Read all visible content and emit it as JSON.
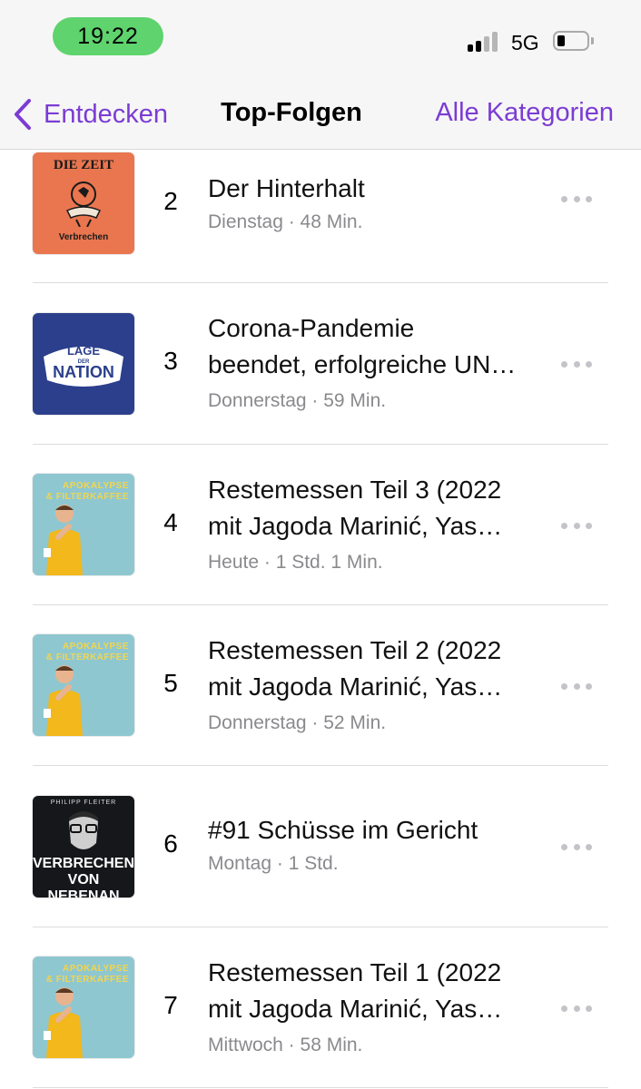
{
  "status_bar": {
    "time": "19:22",
    "network": "5G"
  },
  "nav": {
    "back_label": "Entdecken",
    "title": "Top-Folgen",
    "right_label": "Alle Kategorien"
  },
  "accent_color": "#7b3cd4",
  "episodes": [
    {
      "rank": "2",
      "title_lines": [
        "Der Hinterhalt"
      ],
      "meta": "Dienstag · 48 Min.",
      "artwork": {
        "kind": "zeit",
        "brand": "DIE ZEIT",
        "subtitle": "Verbrechen"
      }
    },
    {
      "rank": "3",
      "title_lines": [
        "Corona-Pandemie",
        "beendet, erfolgreiche UN…"
      ],
      "meta": "Donnerstag · 59 Min.",
      "artwork": {
        "kind": "lage",
        "word1": "LAGE",
        "word2": "DER",
        "word3": "NATION"
      }
    },
    {
      "rank": "4",
      "title_lines": [
        "Restemessen Teil 3 (2022",
        "mit Jagoda Marinić, Yas…"
      ],
      "meta": "Heute · 1 Std. 1 Min.",
      "artwork": {
        "kind": "apokalypse",
        "line1": "APOKALYPSE",
        "line2": "& FILTERKAFFEE"
      }
    },
    {
      "rank": "5",
      "title_lines": [
        "Restemessen Teil 2 (2022",
        "mit Jagoda Marinić, Yas…"
      ],
      "meta": "Donnerstag · 52 Min.",
      "artwork": {
        "kind": "apokalypse",
        "line1": "APOKALYPSE",
        "line2": "& FILTERKAFFEE"
      }
    },
    {
      "rank": "6",
      "title_lines": [
        "#91 Schüsse im Gericht"
      ],
      "meta": "Montag · 1 Std.",
      "artwork": {
        "kind": "verbrechen",
        "top": "PHILIPP FLEITER",
        "line1": "VERBRECHEN",
        "line2": "VON NEBENAN"
      }
    },
    {
      "rank": "7",
      "title_lines": [
        "Restemessen Teil 1 (2022",
        "mit Jagoda Marinić, Yas…"
      ],
      "meta": "Mittwoch · 58 Min.",
      "artwork": {
        "kind": "apokalypse",
        "line1": "APOKALYPSE",
        "line2": "& FILTERKAFFEE"
      }
    }
  ]
}
